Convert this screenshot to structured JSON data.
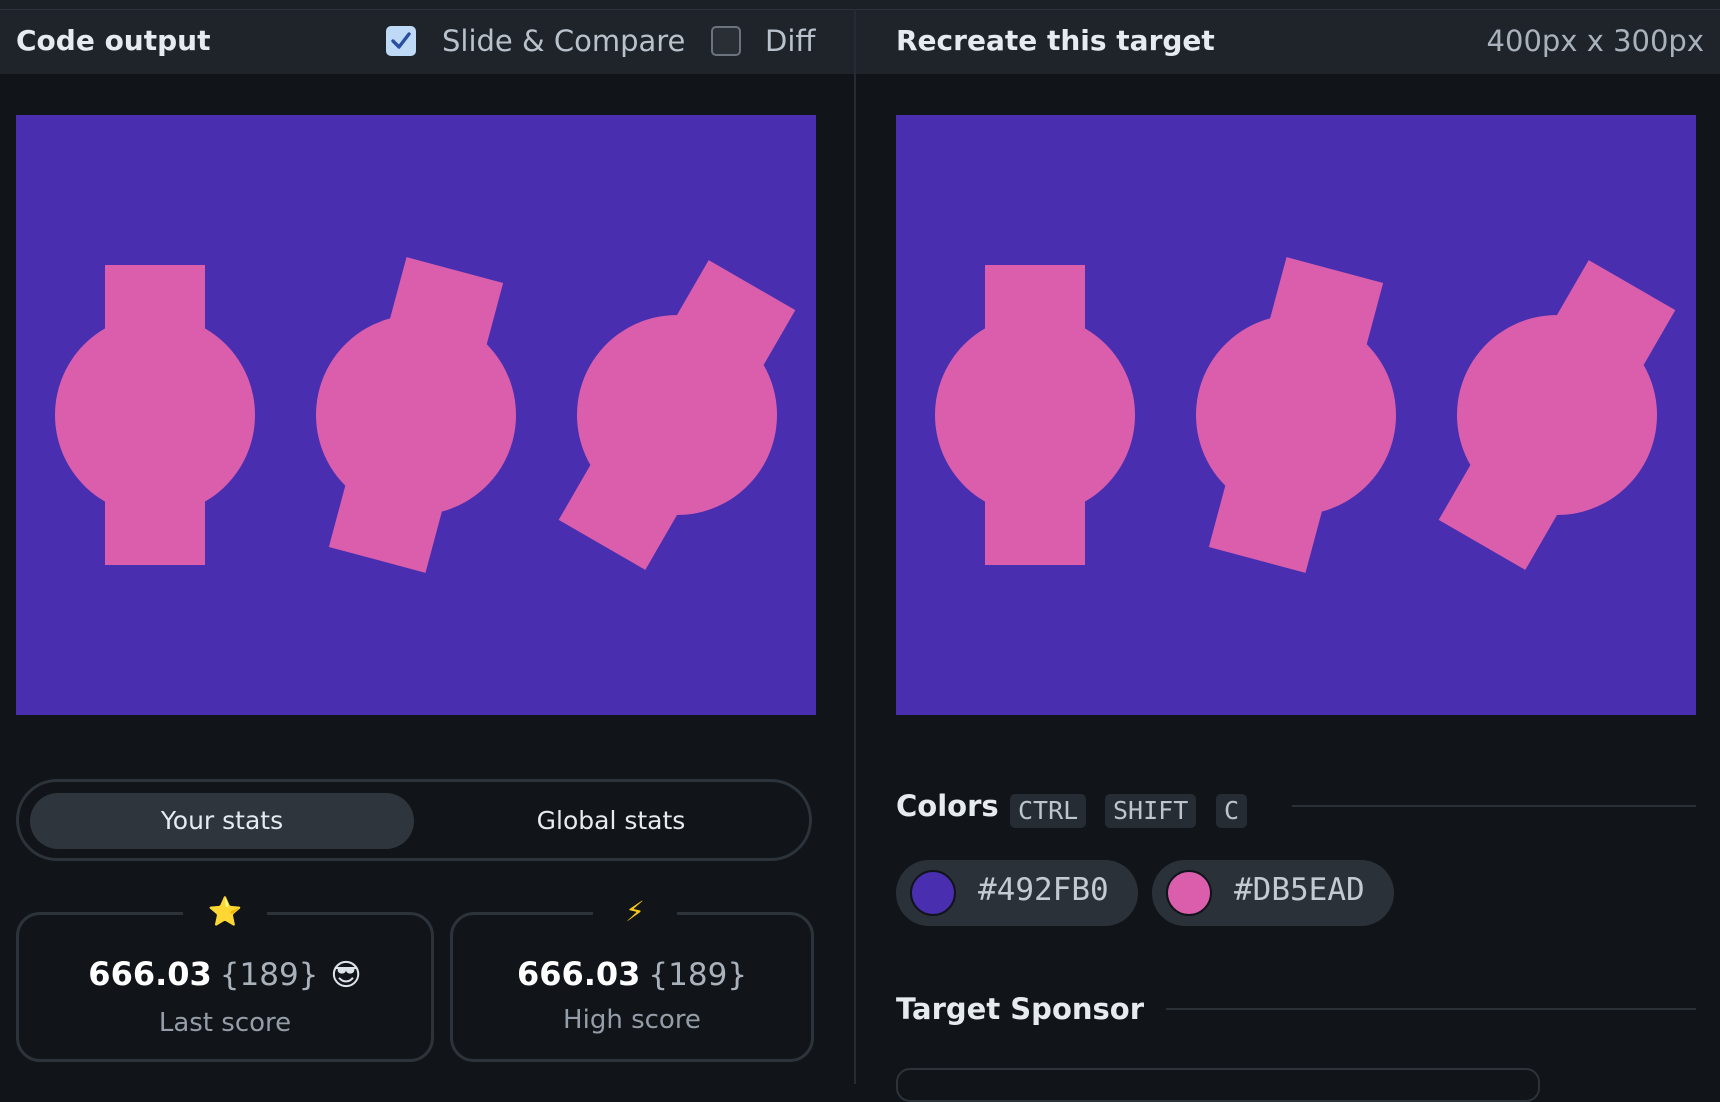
{
  "left_panel": {
    "title": "Code output",
    "slide_compare": {
      "label": "Slide & Compare",
      "checked": true
    },
    "diff": {
      "label": "Diff",
      "checked": false
    }
  },
  "right_panel": {
    "title": "Recreate this target",
    "dimensions": "400px x 300px"
  },
  "canvas": {
    "background": "#492FB0",
    "shape_color": "#DB5EAD"
  },
  "stats": {
    "tabs": [
      "Your stats",
      "Global stats"
    ],
    "active_tab": "Your stats",
    "last": {
      "icon": "⭐",
      "value": "666.03",
      "sub": "{189}",
      "emoji": "😎",
      "label": "Last score"
    },
    "high": {
      "icon": "⚡",
      "value": "666.03",
      "sub": "{189}",
      "label": "High score"
    }
  },
  "colors_section": {
    "title": "Colors",
    "shortcut": [
      "CTRL",
      "SHIFT",
      "C"
    ],
    "swatches": [
      {
        "hex": "#492FB0",
        "label": "#492FB0"
      },
      {
        "hex": "#DB5EAD",
        "label": "#DB5EAD"
      }
    ]
  },
  "sponsor_section": {
    "title": "Target Sponsor"
  }
}
